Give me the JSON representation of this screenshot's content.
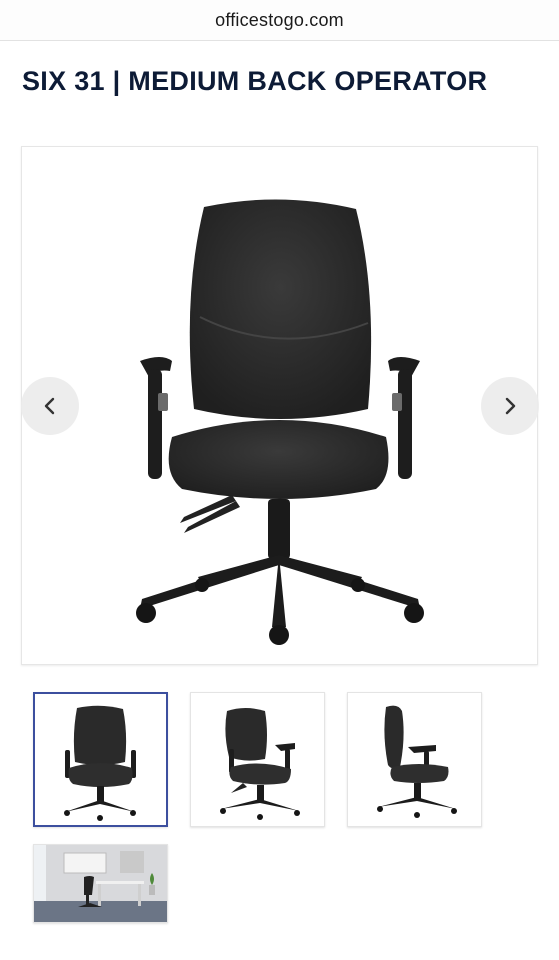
{
  "browser": {
    "url": "officestogo.com"
  },
  "product": {
    "title": "SIX 31 | MEDIUM BACK OPERATOR"
  },
  "gallery": {
    "main_image": "chair-front-view",
    "prev_icon": "chevron-left-icon",
    "next_icon": "chevron-right-icon",
    "thumbnails": [
      {
        "view": "front",
        "selected": true
      },
      {
        "view": "three-quarter",
        "selected": false
      },
      {
        "view": "side",
        "selected": false
      },
      {
        "view": "in-office-scene",
        "selected": false
      }
    ],
    "selected_border_color": "#3c4f9e"
  },
  "colors": {
    "title": "#0d1b36",
    "chair": "#2b2b2b",
    "nav_bg": "#ececec"
  }
}
